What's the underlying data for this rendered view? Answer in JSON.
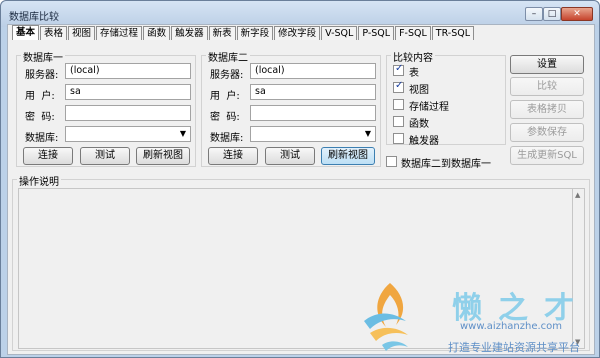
{
  "window": {
    "title": "数据库比较",
    "min": "–",
    "max": "□",
    "close": "✕"
  },
  "tabs": [
    "基本",
    "表格",
    "视图",
    "存储过程",
    "函数",
    "触发器",
    "新表",
    "新字段",
    "修改字段",
    "V-SQL",
    "P-SQL",
    "F-SQL",
    "TR-SQL"
  ],
  "db1": {
    "legend": "数据库一",
    "server_label": "服务器:",
    "server_value": "(local)",
    "user_label": "用  户:",
    "user_value": "sa",
    "pwd_label": "密  码:",
    "pwd_value": "",
    "db_label": "数据库:",
    "db_value": "",
    "btn_connect": "连接",
    "btn_test": "测试",
    "btn_refresh": "刷新视图"
  },
  "db2": {
    "legend": "数据库二",
    "server_label": "服务器:",
    "server_value": "(local)",
    "user_label": "用  户:",
    "user_value": "sa",
    "pwd_label": "密  码:",
    "pwd_value": "",
    "db_label": "数据库:",
    "db_value": "",
    "btn_connect": "连接",
    "btn_test": "测试",
    "btn_refresh": "刷新视图"
  },
  "compare": {
    "legend": "比较内容",
    "items": [
      {
        "label": "表",
        "checked": true
      },
      {
        "label": "视图",
        "checked": true
      },
      {
        "label": "存储过程",
        "checked": false
      },
      {
        "label": "函数",
        "checked": false
      },
      {
        "label": "触发器",
        "checked": false
      }
    ],
    "direction_label": "数据库二到数据库一"
  },
  "actions": {
    "settings": "设置",
    "compare": "比较",
    "copy_table": "表格拷贝",
    "save_params": "参数保存",
    "gen_sql": "生成更新SQL"
  },
  "ops": {
    "legend": "操作说明"
  },
  "watermark": {
    "name": "懒之才",
    "url": "www.aizhanzhe.com",
    "slogan": "打造专业建站资源共享平台"
  }
}
